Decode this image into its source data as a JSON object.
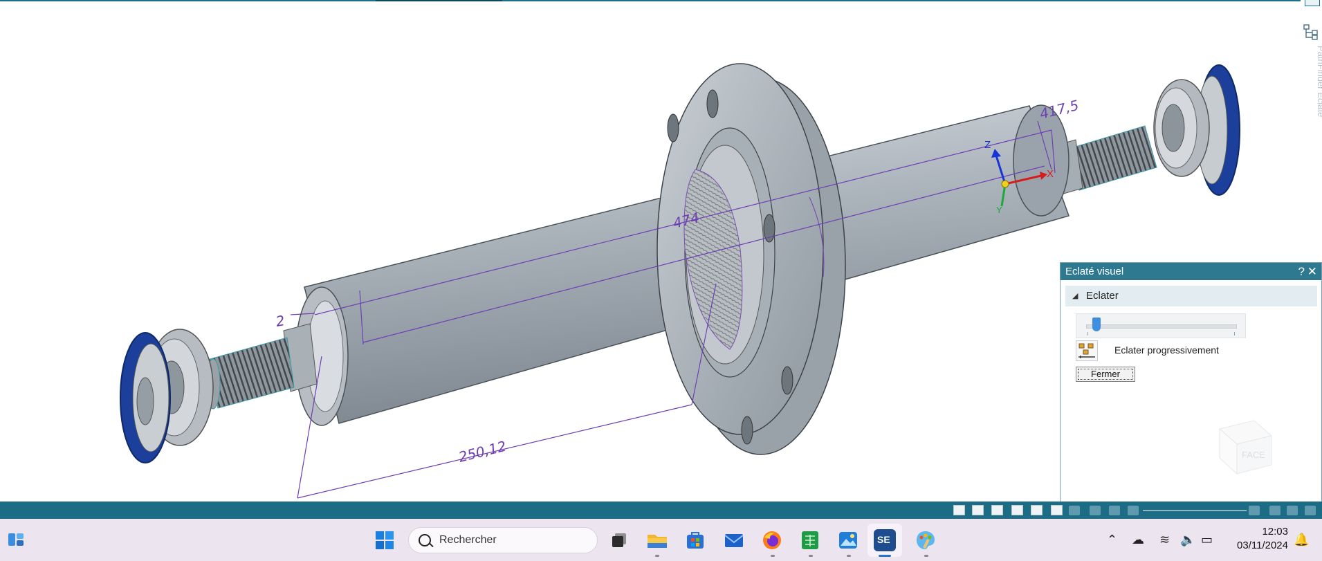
{
  "viewport": {
    "dimensions": [
      "2",
      "474",
      "417,5",
      "250,12"
    ],
    "axes": {
      "x": "X",
      "y": "Y",
      "z": "Z"
    }
  },
  "pathfinder": {
    "label": "PathFinder Eclaté"
  },
  "panel": {
    "title": "Eclaté visuel",
    "help": "?",
    "close": "✕",
    "section": "Eclater",
    "slider_fraction": 0.05,
    "progressive_label": "Eclater progressivement",
    "close_button": "Fermer",
    "watermark": "FACE"
  },
  "taskbar": {
    "search_placeholder": "Rechercher",
    "time": "12:03",
    "date": "03/11/2024",
    "apps": [
      "widgets-icon",
      "start-icon",
      "search",
      "task-view-icon",
      "file-explorer-icon",
      "microsoft-store-icon",
      "mail-icon",
      "firefox-icon",
      "spreadsheet-icon",
      "photos-icon",
      "solid-edge-icon",
      "paint-icon"
    ],
    "se_label": "SE"
  },
  "colors": {
    "teal": "#1d6c85",
    "dimension": "#6d3fb3",
    "shaft": "#a9b1b8",
    "bearing_cap": "#1b3f9a"
  }
}
